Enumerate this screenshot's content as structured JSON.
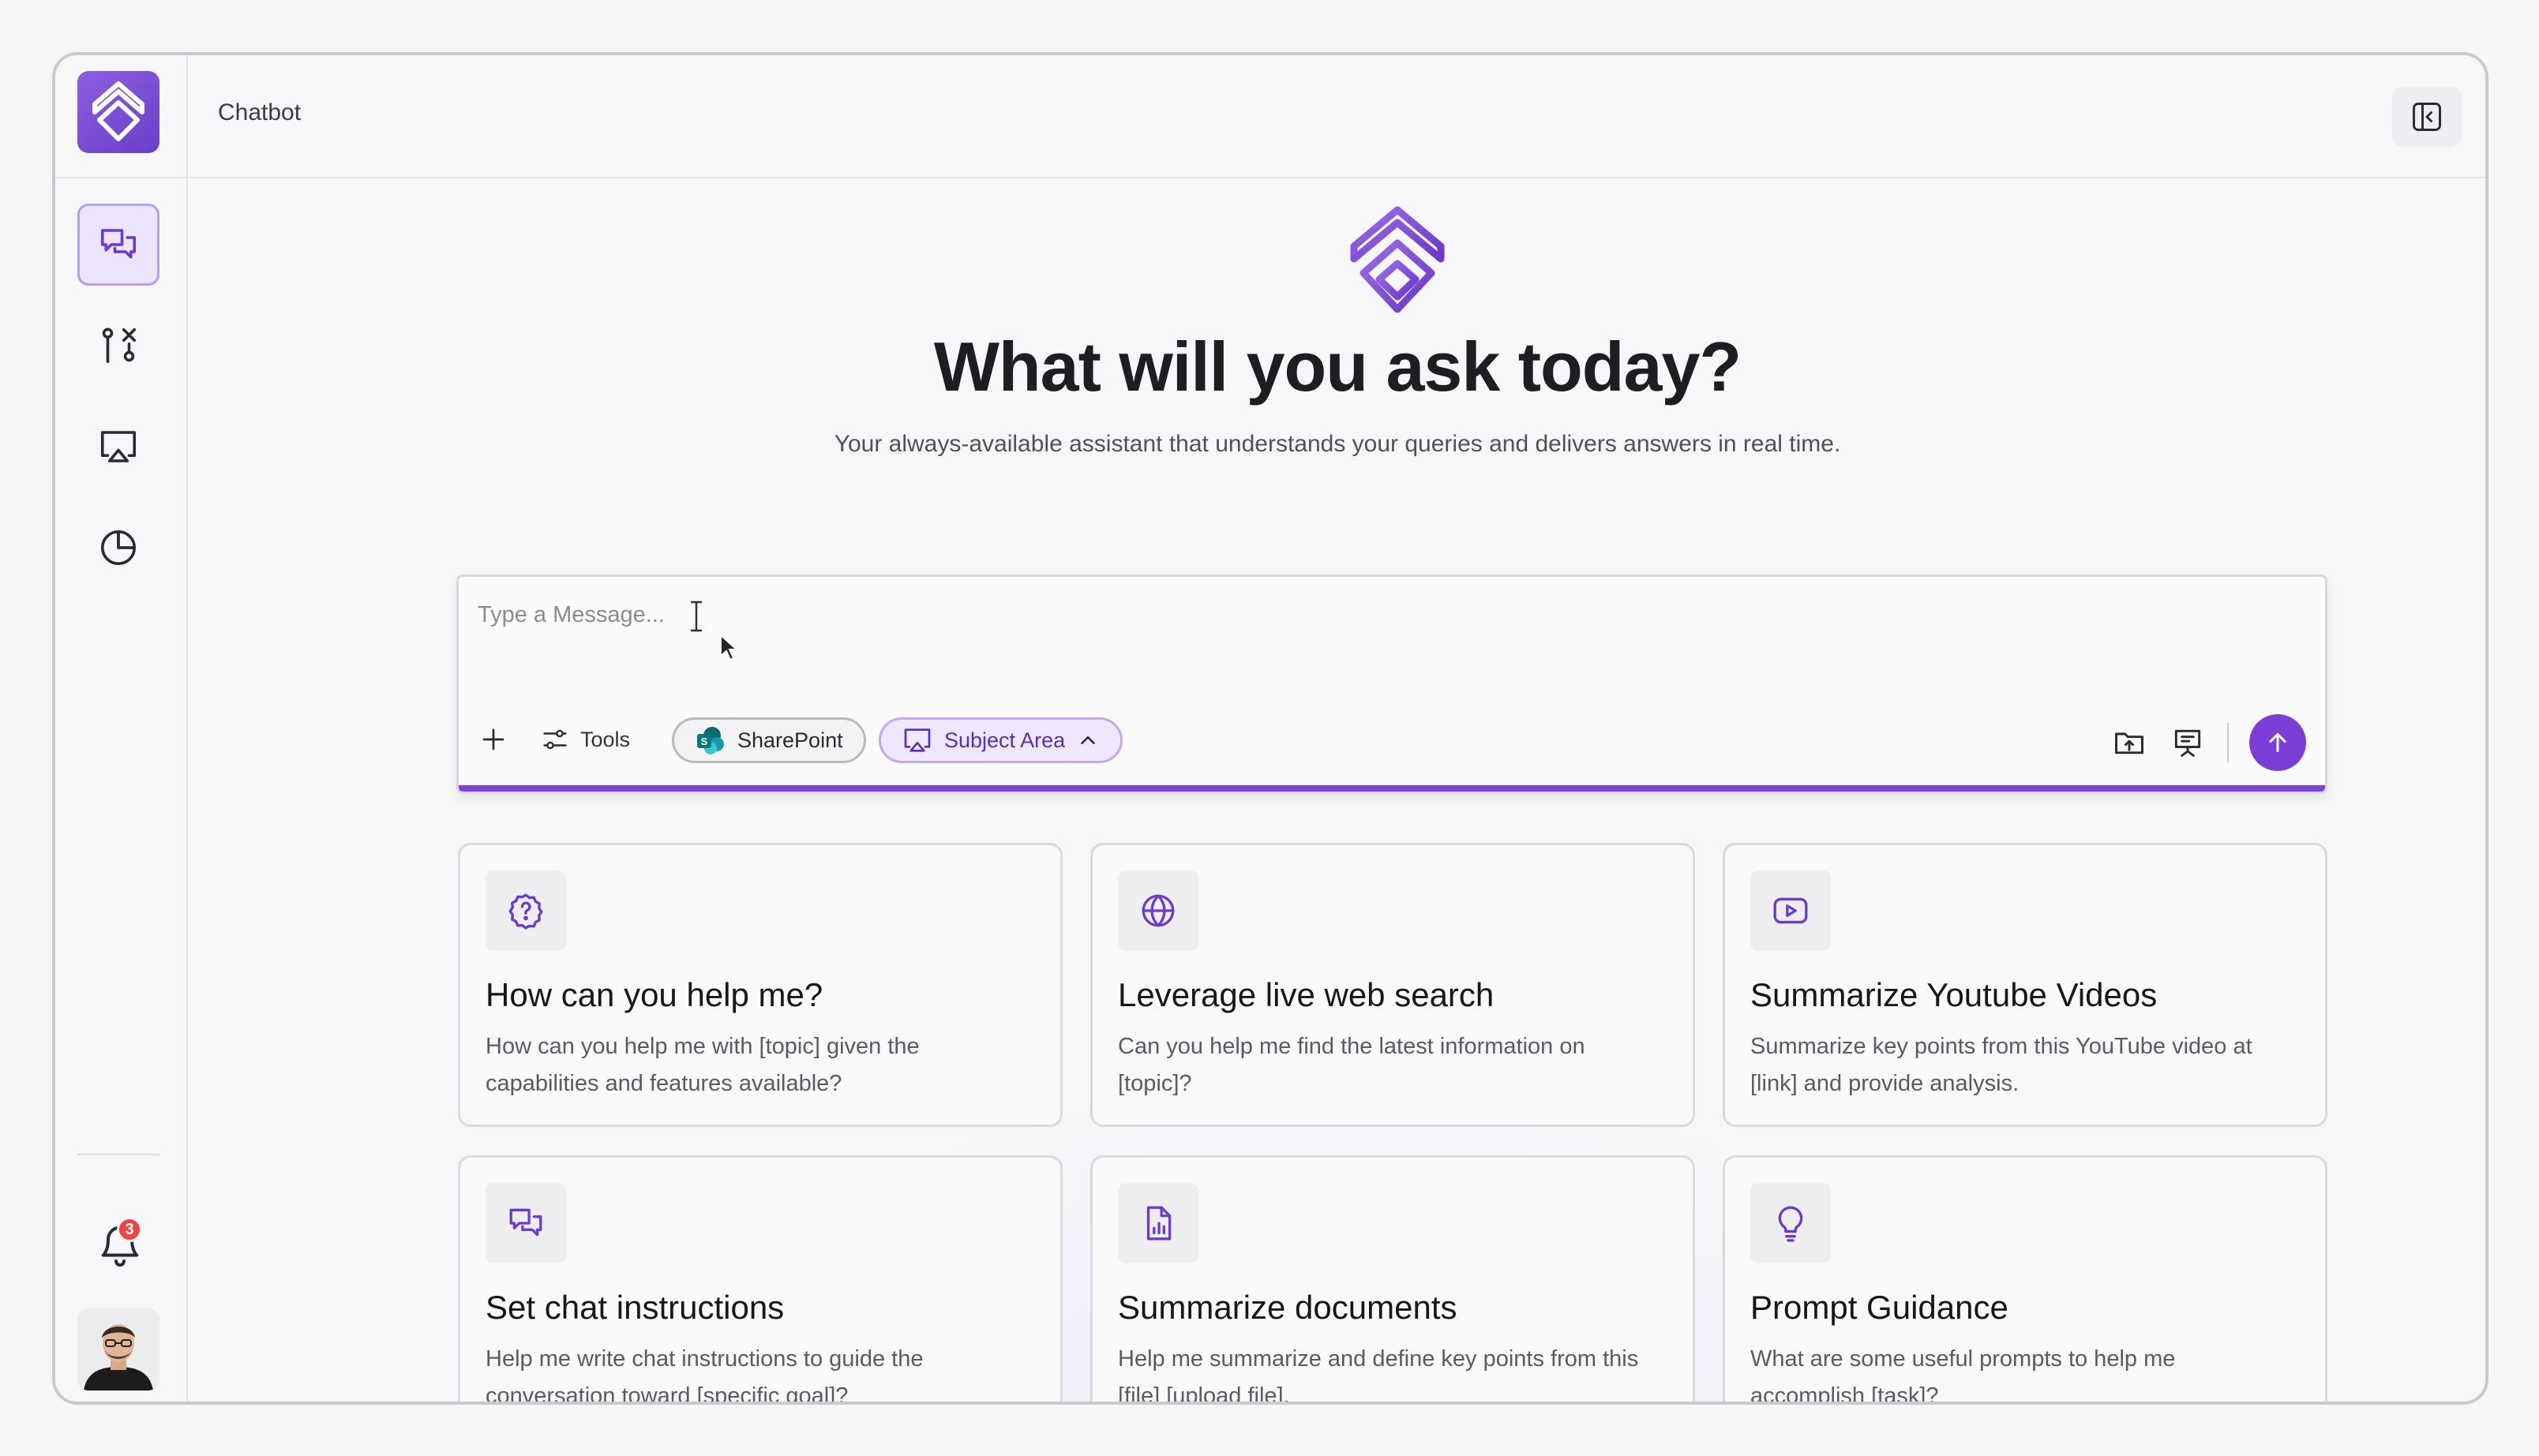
{
  "app": {
    "header_title": "Chatbot"
  },
  "colors": {
    "accent": "#7b3fd8",
    "accent_light": "#efe7fc",
    "badge": "#ef4444"
  },
  "sidebar": {
    "items": [
      {
        "name": "chat",
        "icon": "chat-bubbles-icon",
        "active": true
      },
      {
        "name": "workflows",
        "icon": "git-compare-icon",
        "active": false
      },
      {
        "name": "presentations",
        "icon": "airplay-icon",
        "active": false
      },
      {
        "name": "analytics",
        "icon": "pie-chart-icon",
        "active": false
      }
    ],
    "notifications_count": "3"
  },
  "hero": {
    "title": "What will you ask today?",
    "subtitle": "Your always-available assistant that understands your queries and delivers answers in real time."
  },
  "composer": {
    "placeholder": "Type a Message...",
    "tools_label": "Tools",
    "sharepoint_label": "SharePoint",
    "subject_area_label": "Subject Area"
  },
  "cards": [
    {
      "icon": "help-badge-icon",
      "title": "How can you help me?",
      "desc": "How can you help me with [topic] given the capabilities and features available?"
    },
    {
      "icon": "globe-icon",
      "title": "Leverage live web search",
      "desc": "Can you help me find the latest information on [topic]?"
    },
    {
      "icon": "youtube-icon",
      "title": "Summarize Youtube Videos",
      "desc": "Summarize key points from this YouTube video at [link] and provide analysis."
    },
    {
      "icon": "chat-bubbles-icon",
      "title": "Set chat instructions",
      "desc": "Help me write chat instructions to guide the conversation toward [specific goal]?"
    },
    {
      "icon": "document-chart-icon",
      "title": "Summarize documents",
      "desc": "Help me summarize and define key points from this [file] [upload file]."
    },
    {
      "icon": "lightbulb-icon",
      "title": "Prompt Guidance",
      "desc": "What are some useful prompts to help me accomplish [task]?"
    }
  ]
}
